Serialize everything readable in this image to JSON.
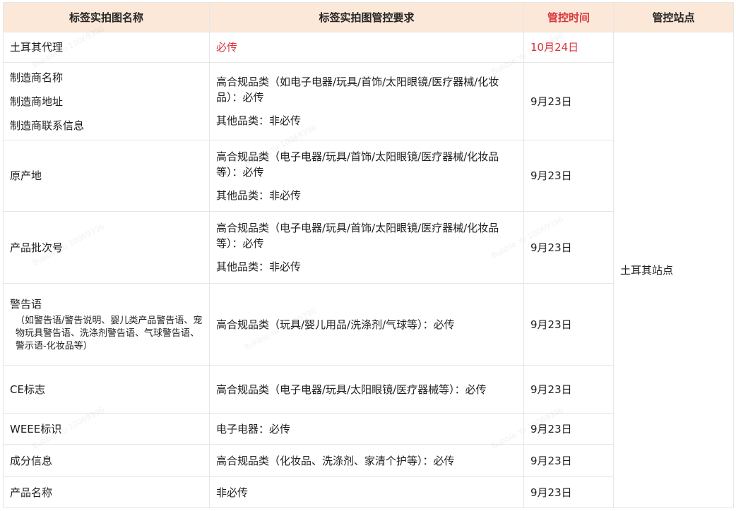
{
  "headers": {
    "name": "标签实拍图名称",
    "requirement": "标签实拍图管控要求",
    "time": "管控时间",
    "site": "管控站点"
  },
  "site_value": "土耳其站点",
  "rows": [
    {
      "name_lines": [
        "土耳其代理"
      ],
      "requirement_lines": [
        "必传"
      ],
      "time": "10月24日"
    },
    {
      "name_lines": [
        "制造商名称",
        "制造商地址",
        "制造商联系信息"
      ],
      "requirement_lines": [
        "高合规品类（如电子电器/玩具/首饰/太阳眼镜/医疗器械/化妆品）：必传",
        "其他品类：非必传"
      ],
      "time": "9月23日"
    },
    {
      "name_lines": [
        "原产地"
      ],
      "requirement_lines": [
        "高合规品类（电子电器/玩具/首饰/太阳眼镜/医疗器械/化妆品等）：必传",
        "其他品类：非必传"
      ],
      "time": "9月23日"
    },
    {
      "name_lines": [
        "产品批次号"
      ],
      "requirement_lines": [
        "高合规品类（电子电器/玩具/首饰/太阳眼镜/医疗器械/化妆品等）：必传",
        "其他品类：非必传"
      ],
      "time": "9月23日"
    },
    {
      "name_lines": [
        "警告语"
      ],
      "name_note": "（如警告语/警告说明、婴儿类产品警告语、宠物玩具警告语、洗涤剂警告语、气球警告语、警示语-化妆品等）",
      "requirement_lines": [
        "高合规品类（玩具/婴儿用品/洗涤剂/气球等）：必传"
      ],
      "time": "9月23日"
    },
    {
      "name_lines": [
        "CE标志"
      ],
      "requirement_lines": [
        "高合规品类（电子电器/玩具/太阳眼镜/医疗器械等）：必传"
      ],
      "time": "9月23日"
    },
    {
      "name_lines": [
        "WEEE标识"
      ],
      "requirement_lines": [
        "电子电器：必传"
      ],
      "time": "9月23日"
    },
    {
      "name_lines": [
        "成分信息"
      ],
      "requirement_lines": [
        "高合规品类（化妆品、洗涤剂、家清个护等）：必传"
      ],
      "time": "9月23日"
    },
    {
      "name_lines": [
        "产品名称"
      ],
      "requirement_lines": [
        "非必传"
      ],
      "time": "9月23日"
    }
  ],
  "watermark": "Bubble Yu 10069396"
}
